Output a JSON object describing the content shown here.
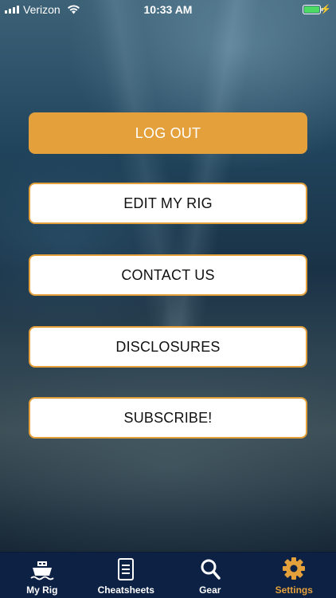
{
  "status_bar": {
    "carrier": "Verizon",
    "time": "10:33 AM"
  },
  "buttons": {
    "logout": "LOG OUT",
    "edit_rig": "EDIT MY RIG",
    "contact": "CONTACT US",
    "disclosures": "DISCLOSURES",
    "subscribe": "SUBSCRIBE!"
  },
  "tabs": [
    {
      "label": "My Rig",
      "icon": "boat-icon"
    },
    {
      "label": "Cheatsheets",
      "icon": "notebook-icon"
    },
    {
      "label": "Gear",
      "icon": "search-icon"
    },
    {
      "label": "Settings",
      "icon": "gear-icon",
      "active": true
    }
  ],
  "colors": {
    "accent": "#e3a03b",
    "tabbar": "#0c2144",
    "battery": "#4cd964"
  }
}
